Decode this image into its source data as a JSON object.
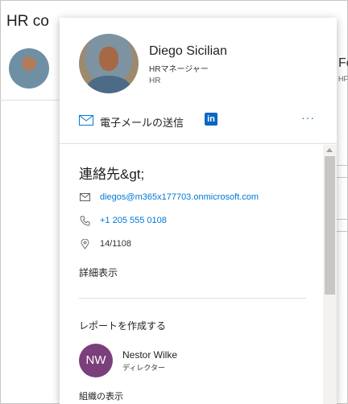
{
  "background": {
    "title": "HR co",
    "partial_right_text": "Fo",
    "partial_right_sub": "HF"
  },
  "card": {
    "name": "Diego Sicilian",
    "job_title": "HRマネージャー",
    "department": "HR",
    "actions": {
      "send_email": "電子メールの送信",
      "linkedin": "in",
      "more": "···"
    },
    "contact": {
      "section_title": "連絡先&gt;",
      "email": "diegos@m365x177703.onmicrosoft.com",
      "phone": "+1 205 555 0108",
      "office": "14/1108",
      "show_more": "詳細表示"
    },
    "reports": {
      "section_title": "レポートを作成する",
      "person": {
        "initials": "NW",
        "name": "Nestor Wilke",
        "title": "ディレクター",
        "avatar_color": "#7b3f7c"
      }
    },
    "org_link": "組織の表示"
  },
  "colors": {
    "accent": "#0078d4",
    "linkedin": "#0a66c2"
  }
}
